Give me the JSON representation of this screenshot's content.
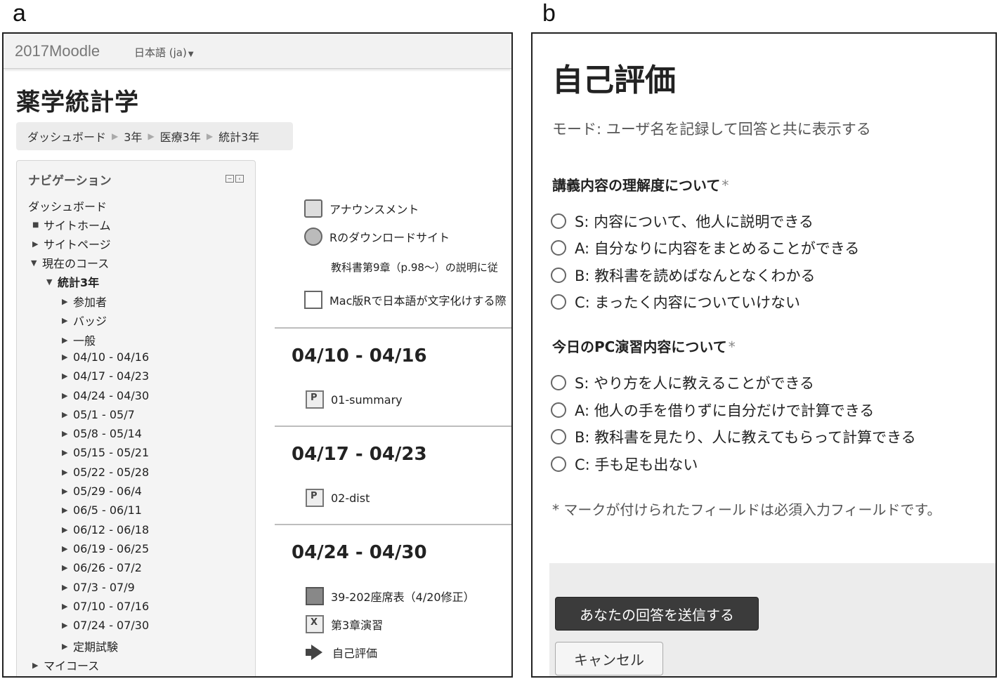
{
  "panel_labels": {
    "a": "a",
    "b": "b"
  },
  "panel_a": {
    "brand": "2017Moodle",
    "language": "日本語 (ja)",
    "course_title": "薬学統計学",
    "breadcrumb": [
      "ダッシュボード",
      "3年",
      "医療3年",
      "統計3年"
    ],
    "navigation": {
      "header": "ナビゲーション",
      "dashboard": "ダッシュボード",
      "site_home": "サイトホーム",
      "site_pages": "サイトページ",
      "current_course": "現在のコース",
      "course": "統計3年",
      "course_items": [
        "参加者",
        "バッジ",
        "一般",
        "04/10 - 04/16",
        "04/17 - 04/23",
        "04/24 - 04/30",
        "05/1 - 05/7",
        "05/8 - 05/14",
        "05/15 - 05/21",
        "05/22 - 05/28",
        "05/29 - 06/4",
        "06/5 - 06/11",
        "06/12 - 06/18",
        "06/19 - 06/25",
        "06/26 - 07/2",
        "07/3 - 07/9",
        "07/10 - 07/16",
        "07/24 - 07/30",
        "定期試験"
      ],
      "my_courses": "マイコース"
    },
    "general_activities": {
      "announcements": "アナウンスメント",
      "r_download": "Rのダウンロードサイト",
      "textbook_note": "教科書第9章（p.98〜）の説明に従",
      "mac_r": "Mac版Rで日本語が文字化けする際"
    },
    "sections": [
      {
        "title": "04/10 - 04/16",
        "items": [
          "01-summary"
        ]
      },
      {
        "title": "04/17 - 04/23",
        "items": [
          "02-dist"
        ]
      },
      {
        "title": "04/24 - 04/30",
        "items": [
          "39-202座席表（4/20修正）",
          "第3章演習",
          "自己評価"
        ]
      }
    ]
  },
  "panel_b": {
    "title": "自己評価",
    "mode": "モード: ユーザ名を記録して回答と共に表示する",
    "questions": [
      {
        "label": "講義内容の理解度について",
        "required_mark": "*",
        "options": [
          "S: 内容について、他人に説明できる",
          "A: 自分なりに内容をまとめることができる",
          "B: 教科書を読めばなんとなくわかる",
          "C: まったく内容についていけない"
        ]
      },
      {
        "label": "今日のPC演習内容について",
        "required_mark": "*",
        "options": [
          "S: やり方を人に教えることができる",
          "A: 他人の手を借りずに自分だけで計算できる",
          "B: 教科書を見たり、人に教えてもらって計算できる",
          "C: 手も足も出ない"
        ]
      }
    ],
    "required_note": "* マークが付けられたフィールドは必須入力フィールドです。",
    "submit_label": "あなたの回答を送信する",
    "cancel_label": "キャンセル"
  }
}
